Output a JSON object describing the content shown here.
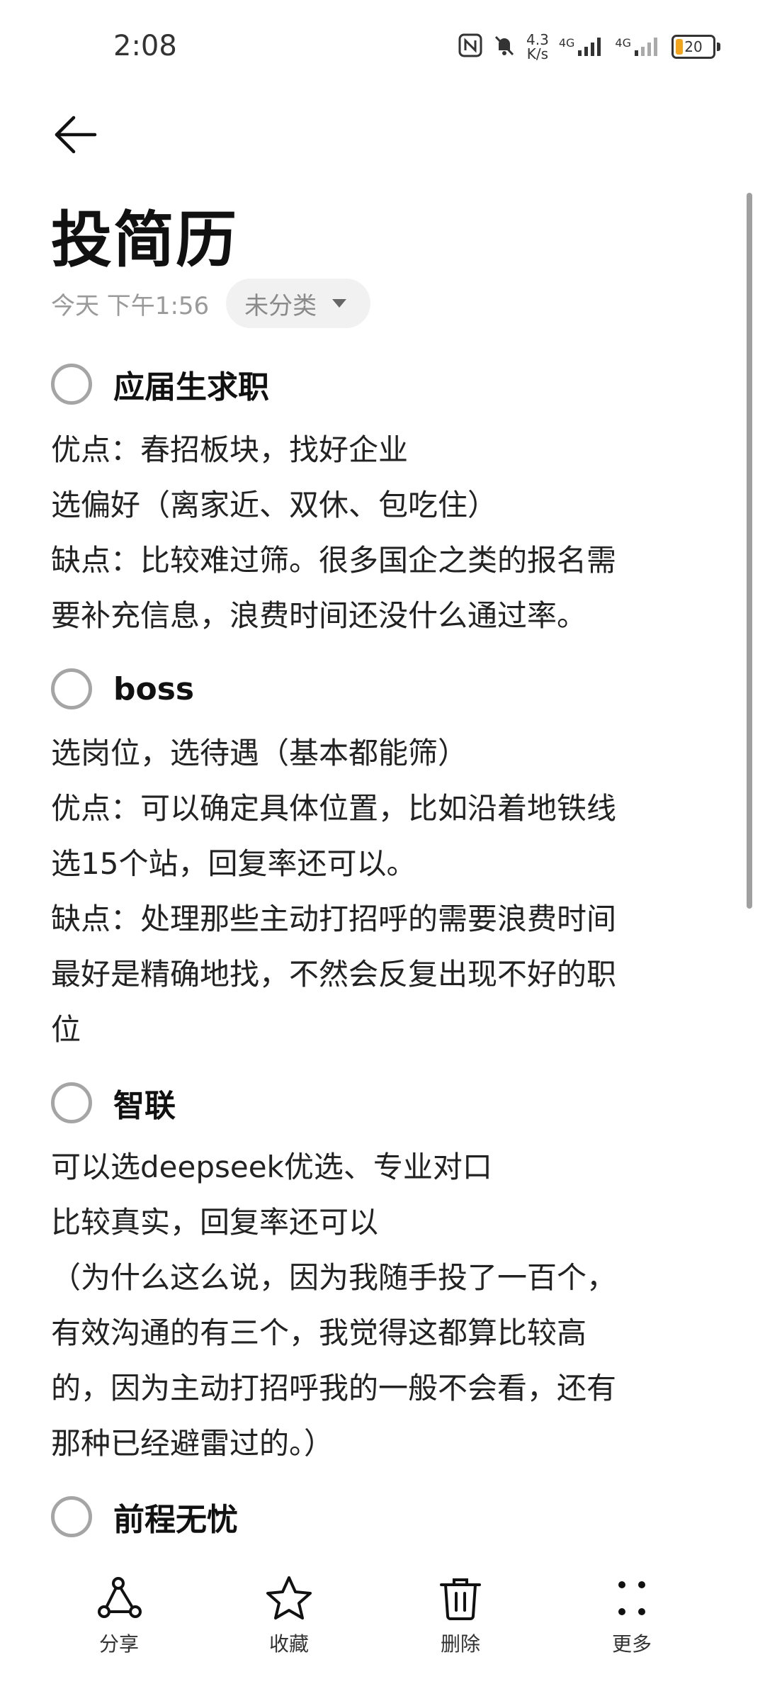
{
  "status_bar": {
    "time": "2:08",
    "net_speed_value": "4.3",
    "net_speed_unit": "K/s",
    "signal_1": "4G",
    "signal_2": "4G",
    "battery": "20"
  },
  "header": {
    "title": "投简历",
    "date": "今天 下午1:56",
    "category": "未分类"
  },
  "sections": [
    {
      "todo": "应届生求职",
      "lines": [
        "优点：春招板块，找好企业",
        "选偏好（离家近、双休、包吃住）",
        "缺点：比较难过筛。很多国企之类的报名需",
        "要补充信息，浪费时间还没什么通过率。"
      ]
    },
    {
      "todo": "boss",
      "lines": [
        "选岗位，选待遇（基本都能筛）",
        "优点：可以确定具体位置，比如沿着地铁线",
        "选15个站，回复率还可以。",
        "缺点：处理那些主动打招呼的需要浪费时间",
        "最好是精确地找，不然会反复出现不好的职",
        "位"
      ]
    },
    {
      "todo": "智联",
      "lines": [
        "可以选deepseek优选、专业对口",
        "比较真实，回复率还可以",
        "（为什么这么说，因为我随手投了一百个，",
        "有效沟通的有三个，我觉得这都算比较高",
        "的，因为主动打招呼我的一般不会看，还有",
        "那种已经避雷过的。）"
      ]
    },
    {
      "todo": "前程无忧",
      "lines": []
    }
  ],
  "bottom_bar": {
    "share": "分享",
    "favorite": "收藏",
    "delete": "删除",
    "more": "更多"
  }
}
